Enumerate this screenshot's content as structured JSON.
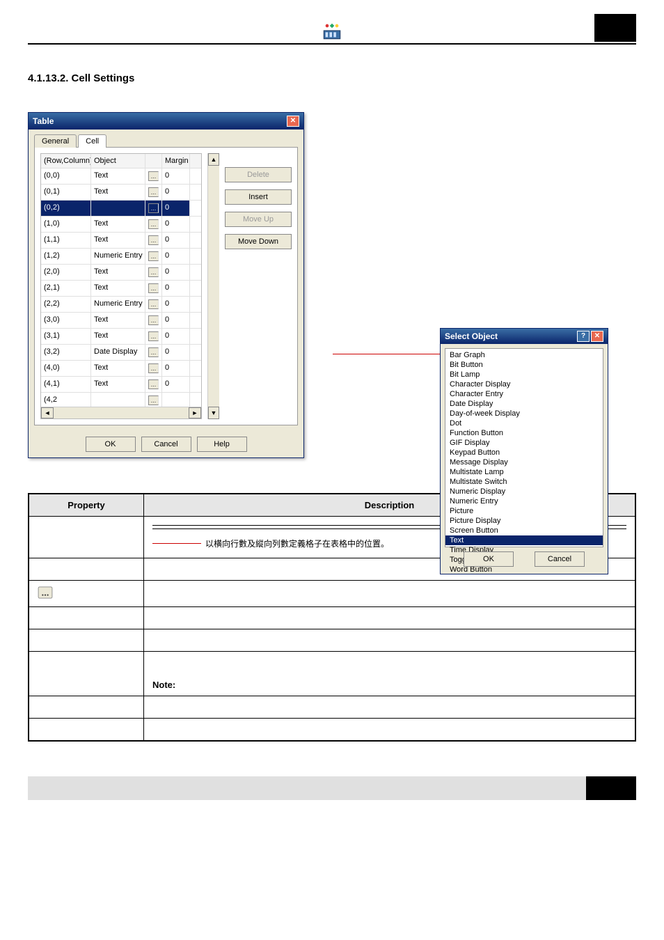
{
  "header": {
    "section_title": "4.1.13.2.  Cell Settings"
  },
  "table_dialog": {
    "title": "Table",
    "tabs": {
      "general": "General",
      "cell": "Cell"
    },
    "active_tab": "Cell",
    "columns": {
      "rc": "(Row,Column)",
      "obj": "Object",
      "margin": "Margin"
    },
    "rows": [
      {
        "rc": "(0,0)",
        "obj": "Text",
        "margin": "0",
        "sel": false
      },
      {
        "rc": "(0,1)",
        "obj": "Text",
        "margin": "0",
        "sel": false
      },
      {
        "rc": "(0,2)",
        "obj": "",
        "margin": "0",
        "sel": true
      },
      {
        "rc": "(1,0)",
        "obj": "Text",
        "margin": "0",
        "sel": false
      },
      {
        "rc": "(1,1)",
        "obj": "Text",
        "margin": "0",
        "sel": false
      },
      {
        "rc": "(1,2)",
        "obj": "Numeric Entry",
        "margin": "0",
        "sel": false
      },
      {
        "rc": "(2,0)",
        "obj": "Text",
        "margin": "0",
        "sel": false
      },
      {
        "rc": "(2,1)",
        "obj": "Text",
        "margin": "0",
        "sel": false
      },
      {
        "rc": "(2,2)",
        "obj": "Numeric Entry",
        "margin": "0",
        "sel": false
      },
      {
        "rc": "(3,0)",
        "obj": "Text",
        "margin": "0",
        "sel": false
      },
      {
        "rc": "(3,1)",
        "obj": "Text",
        "margin": "0",
        "sel": false
      },
      {
        "rc": "(3,2)",
        "obj": "Date Display",
        "margin": "0",
        "sel": false
      },
      {
        "rc": "(4,0)",
        "obj": "Text",
        "margin": "0",
        "sel": false
      },
      {
        "rc": "(4,1)",
        "obj": "Text",
        "margin": "0",
        "sel": false
      },
      {
        "rc": "(4,2)",
        "obj": "",
        "margin": "",
        "sel": false,
        "cut": true
      }
    ],
    "buttons": {
      "delete": "Delete",
      "insert": "Insert",
      "moveup": "Move Up",
      "movedown": "Move Down"
    },
    "footer": {
      "ok": "OK",
      "cancel": "Cancel",
      "help": "Help"
    }
  },
  "select_object": {
    "title": "Select Object",
    "items": [
      "Bar Graph",
      "Bit Button",
      "Bit Lamp",
      "Character Display",
      "Character Entry",
      "Date Display",
      "Day-of-week Display",
      "Dot",
      "Function Button",
      "GIF Display",
      "Keypad Button",
      "Message Display",
      "Multistate Lamp",
      "Multistate Switch",
      "Numeric Display",
      "Numeric Entry",
      "Picture",
      "Picture Display",
      "Screen Button",
      "Text",
      "Time Display",
      "Toggle Switch",
      "Word Button"
    ],
    "selected_index": 19,
    "footer": {
      "ok": "OK",
      "cancel": "Cancel"
    }
  },
  "prop_table": {
    "head": {
      "prop": "Property",
      "desc": "Description"
    },
    "rowcol_desc": "以横向行數及縱向列數定義格子在表格中的位置。",
    "note_label": "Note:"
  }
}
